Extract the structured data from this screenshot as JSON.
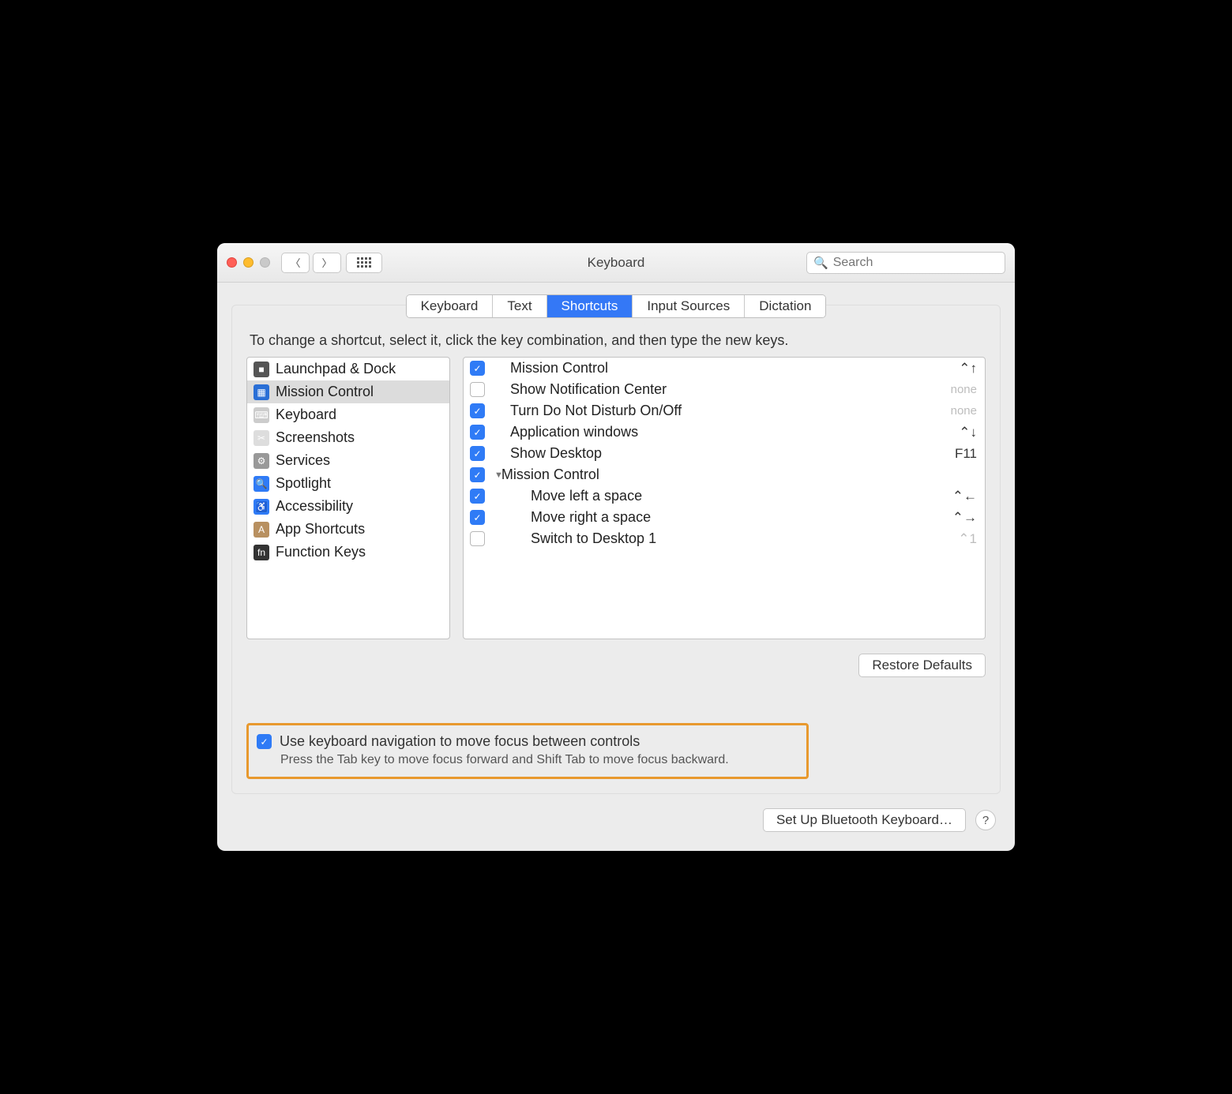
{
  "window": {
    "title": "Keyboard"
  },
  "search": {
    "placeholder": "Search"
  },
  "tabs": [
    "Keyboard",
    "Text",
    "Shortcuts",
    "Input Sources",
    "Dictation"
  ],
  "active_tab": 2,
  "instruction": "To change a shortcut, select it, click the key combination, and then type the new keys.",
  "categories": [
    {
      "label": "Launchpad & Dock",
      "icon_bg": "#555",
      "icon_txt": "■"
    },
    {
      "label": "Mission Control",
      "icon_bg": "#2a6fd6",
      "icon_txt": "▦",
      "selected": true
    },
    {
      "label": "Keyboard",
      "icon_bg": "#ccc",
      "icon_txt": "⌨"
    },
    {
      "label": "Screenshots",
      "icon_bg": "#ddd",
      "icon_txt": "✂"
    },
    {
      "label": "Services",
      "icon_bg": "#999",
      "icon_txt": "⚙"
    },
    {
      "label": "Spotlight",
      "icon_bg": "#2f7bf6",
      "icon_txt": "🔍"
    },
    {
      "label": "Accessibility",
      "icon_bg": "#2f7bf6",
      "icon_txt": "♿"
    },
    {
      "label": "App Shortcuts",
      "icon_bg": "#b89060",
      "icon_txt": "A"
    },
    {
      "label": "Function Keys",
      "icon_bg": "#333",
      "icon_txt": "fn"
    }
  ],
  "shortcuts": [
    {
      "checked": true,
      "label": "Mission Control",
      "key": "⌃↑",
      "indent": "top"
    },
    {
      "checked": false,
      "label": "Show Notification Center",
      "key": "none",
      "key_style": "none",
      "indent": "top"
    },
    {
      "checked": true,
      "label": "Turn Do Not Disturb On/Off",
      "key": "none",
      "key_style": "none",
      "indent": "top"
    },
    {
      "checked": true,
      "label": "Application windows",
      "key": "⌃↓",
      "indent": "top"
    },
    {
      "checked": true,
      "label": "Show Desktop",
      "key": "F11",
      "indent": "top"
    },
    {
      "checked": true,
      "label": "Mission Control",
      "key": "",
      "indent": "group",
      "group": true
    },
    {
      "checked": true,
      "label": "Move left a space",
      "key": "⌃←",
      "indent": "sub"
    },
    {
      "checked": true,
      "label": "Move right a space",
      "key": "⌃→",
      "indent": "sub"
    },
    {
      "checked": false,
      "label": "Switch to Desktop 1",
      "key": "⌃1",
      "key_style": "dim",
      "indent": "sub"
    }
  ],
  "restore_btn": "Restore Defaults",
  "kb_nav": {
    "checked": true,
    "label": "Use keyboard navigation to move focus between controls",
    "desc": "Press the Tab key to move focus forward and Shift Tab to move focus backward."
  },
  "bluetooth_btn": "Set Up Bluetooth Keyboard…"
}
